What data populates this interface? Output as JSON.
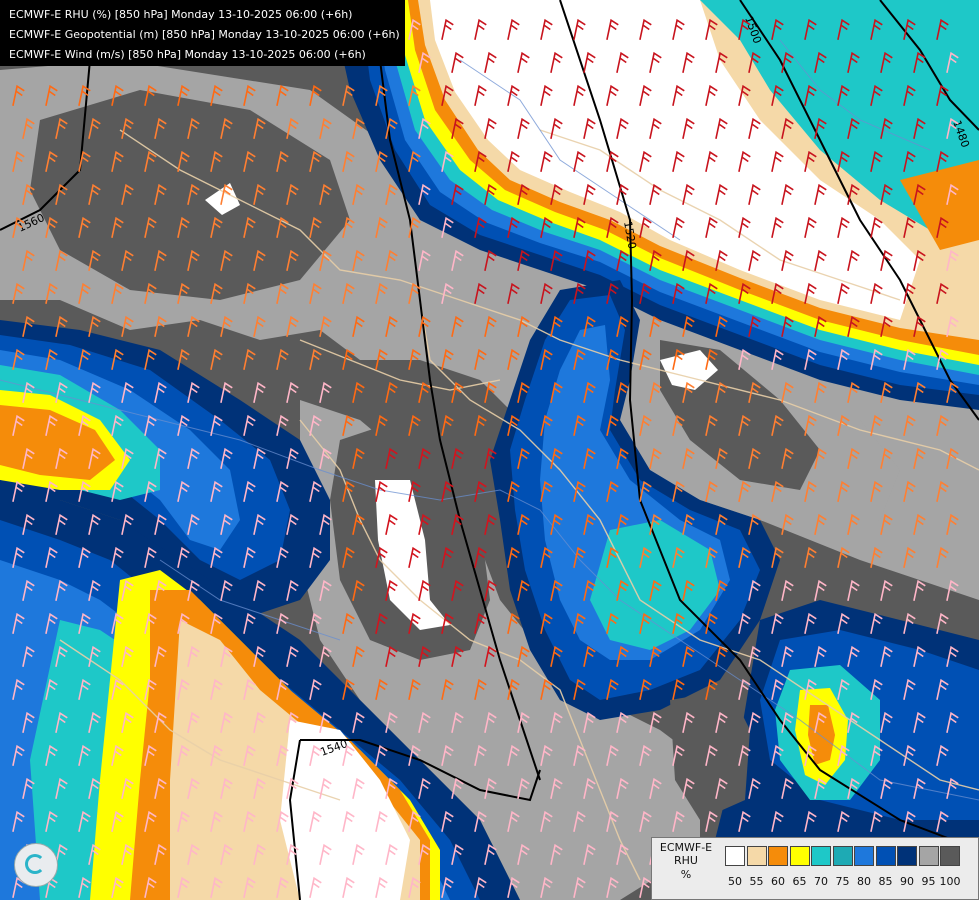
{
  "titles": [
    "ECMWF-E RHU (%) [850 hPa] Monday 13-10-2025 06:00 (+6h)",
    "ECMWF-E Geopotential (m) [850 hPa] Monday 13-10-2025 06:00 (+6h)",
    "ECMWF-E Wind (m/s) [850 hPa] Monday 13-10-2025 06:00 (+6h)"
  ],
  "legend": {
    "label_lines": [
      "ECMWF-E",
      "RHU",
      "%"
    ],
    "ticks": [
      "50",
      "55",
      "60",
      "65",
      "70",
      "75",
      "80",
      "85",
      "90",
      "95",
      "100"
    ],
    "colors": [
      "#ffffff",
      "#f5d9a8",
      "#f58c0a",
      "#ffff00",
      "#1ec8c8",
      "#1eaab4",
      "#1e78dc",
      "#0050b4",
      "#003278",
      "#a5a5a5",
      "#5a5a5a"
    ]
  },
  "contour_labels": [
    "1560",
    "1500",
    "1520",
    "1480",
    "1540"
  ],
  "icons": {
    "logo": "ecmwf-logo-icon"
  }
}
